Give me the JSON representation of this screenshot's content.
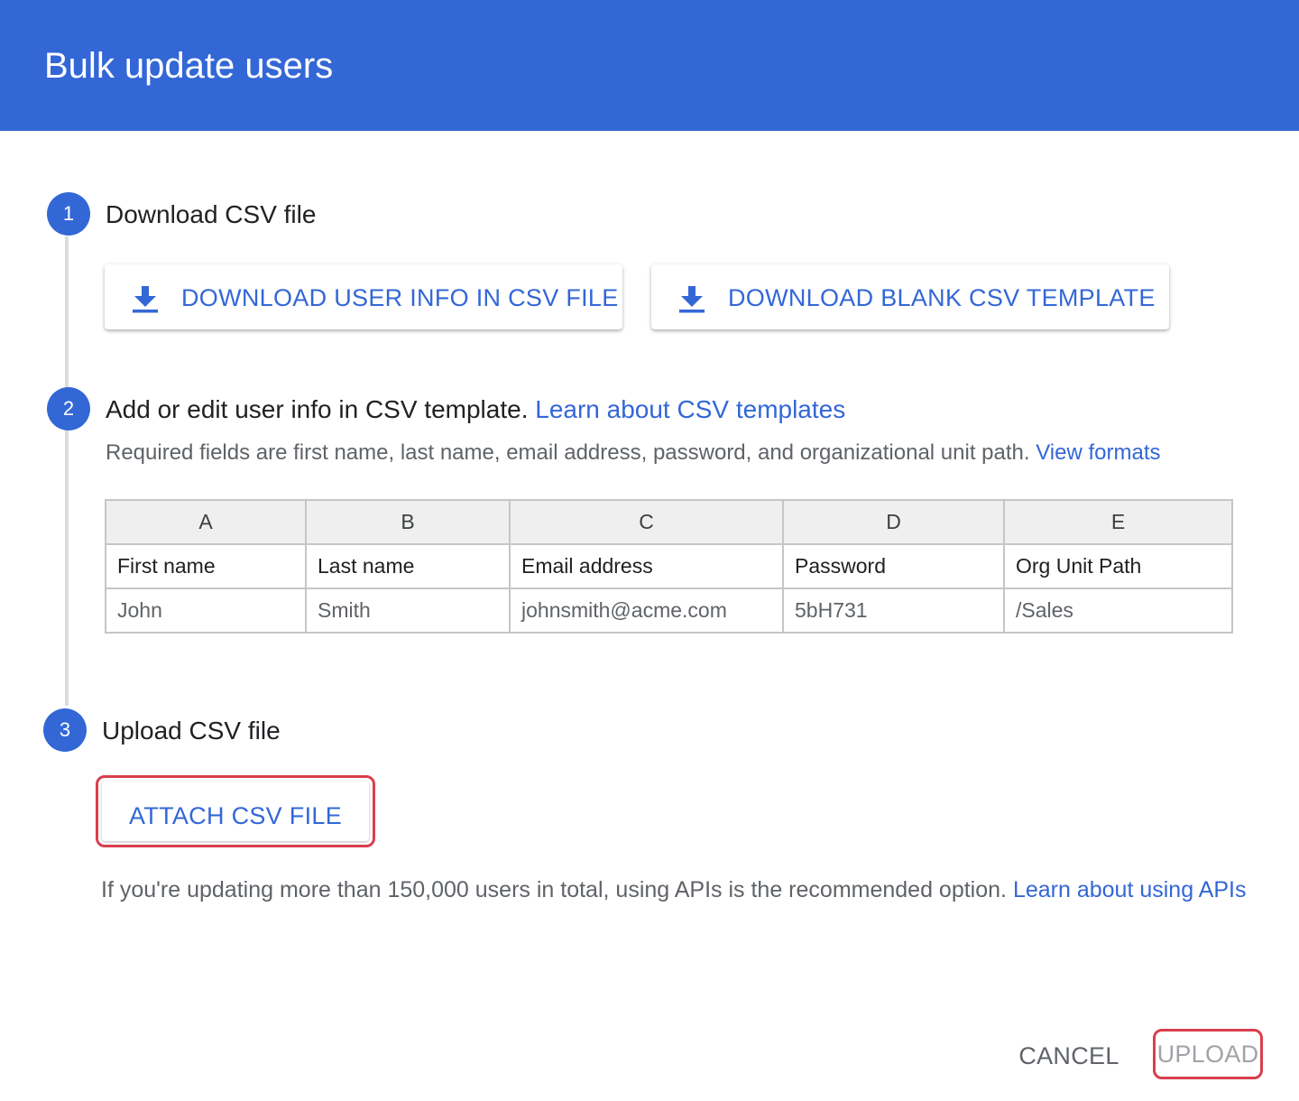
{
  "dialog": {
    "title": "Bulk update users"
  },
  "colors": {
    "primary": "#3367d6",
    "highlight_border": "#d93f4c",
    "disabled_text": "#a0a3a7"
  },
  "steps": [
    {
      "number": "1",
      "title": "Download CSV file",
      "buttons": [
        {
          "label": "DOWNLOAD USER INFO IN CSV FILE",
          "icon": "download-icon"
        },
        {
          "label": "DOWNLOAD BLANK CSV TEMPLATE",
          "icon": "download-icon"
        }
      ]
    },
    {
      "number": "2",
      "title": "Add or edit user info in CSV template.",
      "link": "Learn about CSV templates",
      "description": "Required fields are first name, last name, email address, password, and organizational unit path.",
      "description_link": "View formats"
    },
    {
      "number": "3",
      "title": "Upload CSV file",
      "attach_label": "ATTACH CSV FILE"
    }
  ],
  "csv_table": {
    "column_letters": [
      "A",
      "B",
      "C",
      "D",
      "E"
    ],
    "headers": [
      "First name",
      "Last name",
      "Email address",
      "Password",
      "Org Unit Path"
    ],
    "rows": [
      [
        "John",
        "Smith",
        "johnsmith@acme.com",
        "5bH731",
        "/Sales"
      ]
    ]
  },
  "footer_note": {
    "text": "If you're updating more than 150,000 users in total, using APIs is the recommended option.",
    "link": "Learn about using APIs"
  },
  "actions": {
    "cancel_label": "CANCEL",
    "upload_label": "UPLOAD"
  }
}
